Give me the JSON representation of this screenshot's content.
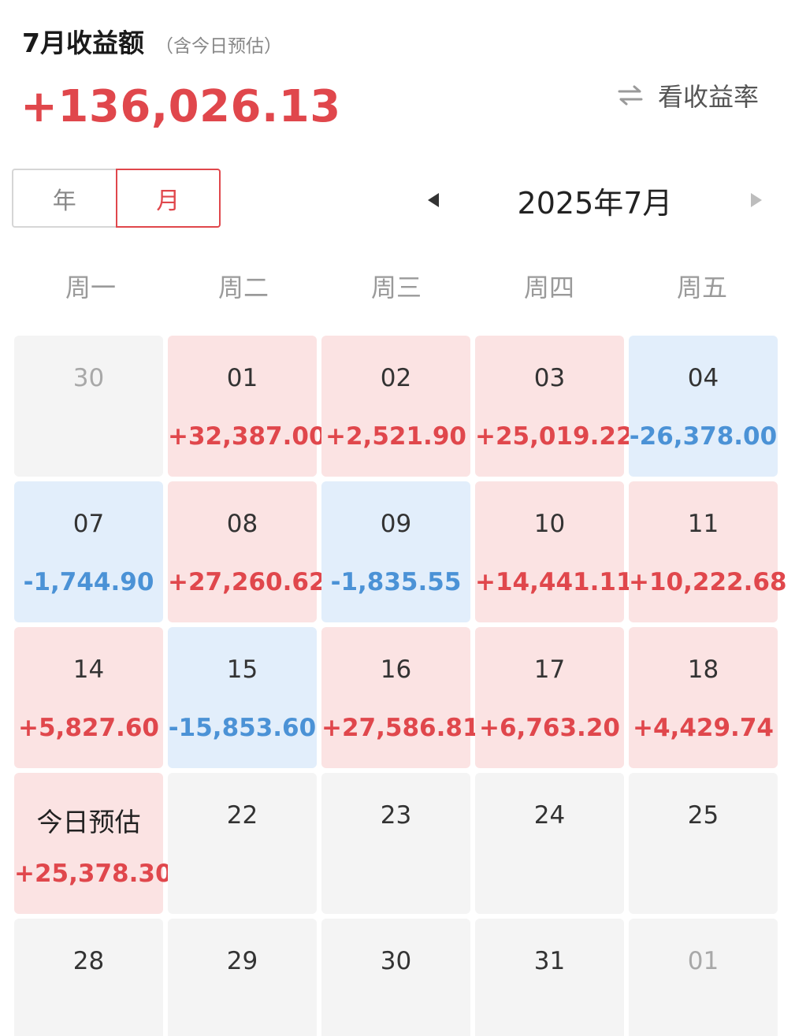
{
  "header": {
    "title": "7月收益额",
    "subtitle": "（含今日预估）",
    "total": "+136,026.13",
    "toggle_label": "看收益率"
  },
  "segment": {
    "year_label": "年",
    "month_label": "月",
    "selected": "月"
  },
  "month_nav": {
    "label": "2025年7月"
  },
  "weekdays": [
    "周一",
    "周二",
    "周三",
    "周四",
    "周五"
  ],
  "colors": {
    "positive": "#e0474c",
    "negative": "#4b92d6",
    "positive_bg": "#fbe3e3",
    "negative_bg": "#e2eefb",
    "empty_bg": "#f4f4f4"
  },
  "days": [
    {
      "label": "30",
      "value": "",
      "type": "none",
      "muted": true
    },
    {
      "label": "01",
      "value": "+32,387.00",
      "type": "pos"
    },
    {
      "label": "02",
      "value": "+2,521.90",
      "type": "pos"
    },
    {
      "label": "03",
      "value": "+25,019.22",
      "type": "pos"
    },
    {
      "label": "04",
      "value": "-26,378.00",
      "type": "neg"
    },
    {
      "label": "07",
      "value": "-1,744.90",
      "type": "neg"
    },
    {
      "label": "08",
      "value": "+27,260.62",
      "type": "pos"
    },
    {
      "label": "09",
      "value": "-1,835.55",
      "type": "neg"
    },
    {
      "label": "10",
      "value": "+14,441.11",
      "type": "pos"
    },
    {
      "label": "11",
      "value": "+10,222.68",
      "type": "pos"
    },
    {
      "label": "14",
      "value": "+5,827.60",
      "type": "pos"
    },
    {
      "label": "15",
      "value": "-15,853.60",
      "type": "neg"
    },
    {
      "label": "16",
      "value": "+27,586.81",
      "type": "pos"
    },
    {
      "label": "17",
      "value": "+6,763.20",
      "type": "pos"
    },
    {
      "label": "18",
      "value": "+4,429.74",
      "type": "pos"
    },
    {
      "label": "今日预估",
      "value": "+25,378.30",
      "type": "pos",
      "today": true
    },
    {
      "label": "22",
      "value": "",
      "type": "none"
    },
    {
      "label": "23",
      "value": "",
      "type": "none"
    },
    {
      "label": "24",
      "value": "",
      "type": "none"
    },
    {
      "label": "25",
      "value": "",
      "type": "none"
    },
    {
      "label": "28",
      "value": "",
      "type": "none"
    },
    {
      "label": "29",
      "value": "",
      "type": "none"
    },
    {
      "label": "30",
      "value": "",
      "type": "none"
    },
    {
      "label": "31",
      "value": "",
      "type": "none"
    },
    {
      "label": "01",
      "value": "",
      "type": "none",
      "muted": true
    }
  ]
}
